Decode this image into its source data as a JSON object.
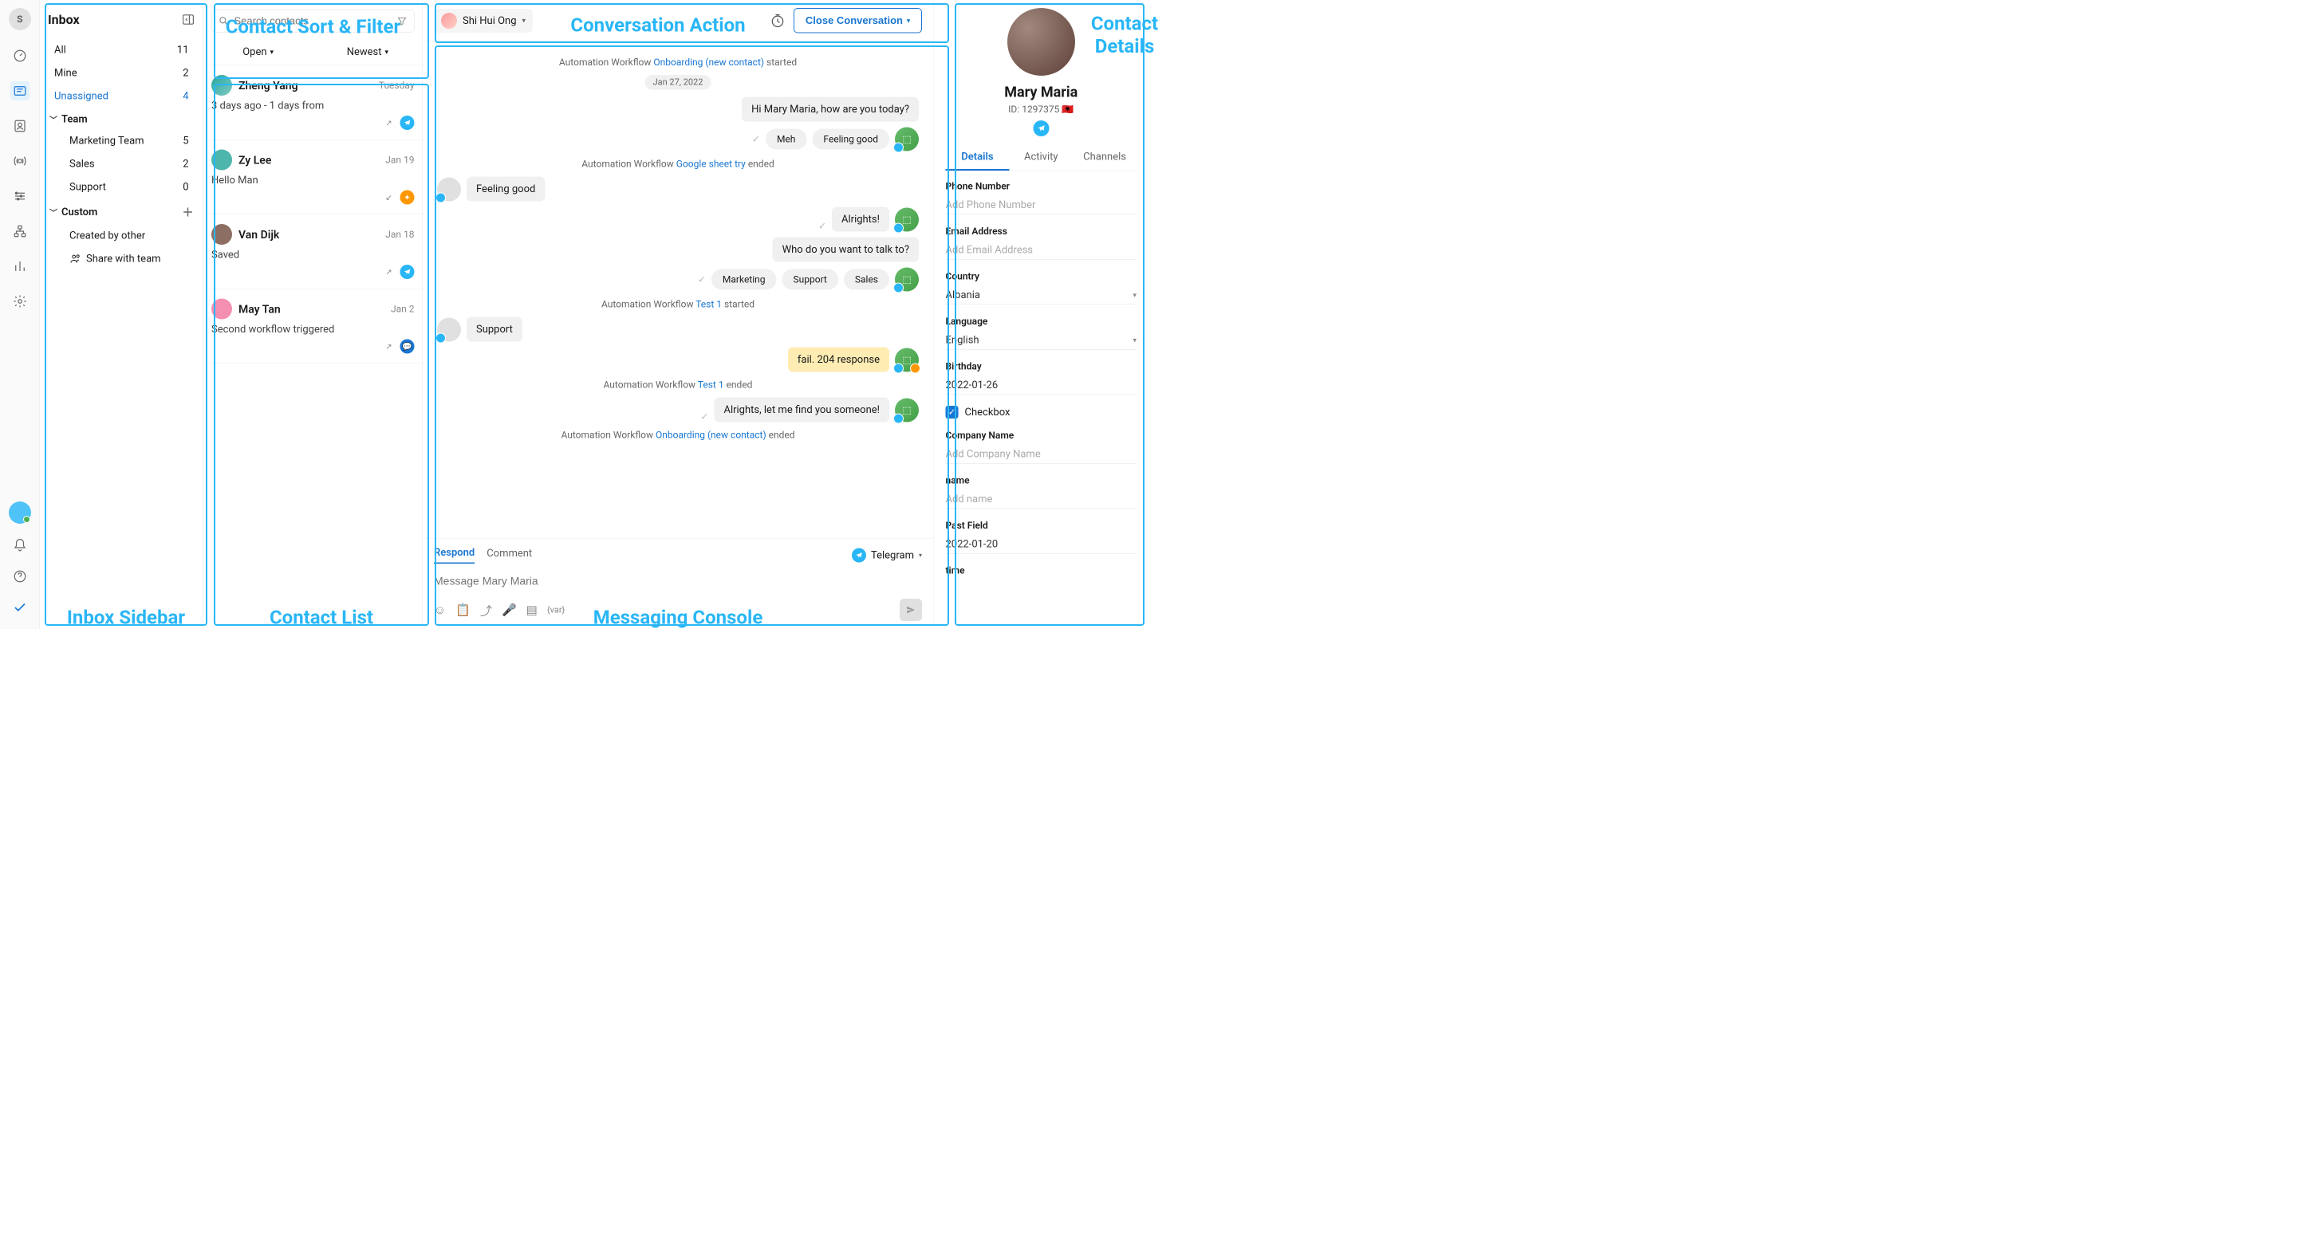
{
  "rail": {
    "avatar_initial": "S"
  },
  "inbox": {
    "title": "Inbox",
    "items": [
      {
        "label": "All",
        "count": "11"
      },
      {
        "label": "Mine",
        "count": "2"
      },
      {
        "label": "Unassigned",
        "count": "4"
      }
    ],
    "team_section": "Team",
    "team_items": [
      {
        "label": "Marketing Team",
        "count": "5"
      },
      {
        "label": "Sales",
        "count": "2"
      },
      {
        "label": "Support",
        "count": "0"
      }
    ],
    "custom_section": "Custom",
    "custom_items": [
      {
        "label": "Created by other"
      }
    ],
    "share_label": "Share with team"
  },
  "contact_list": {
    "search_placeholder": "Search contacts",
    "tab_open": "Open",
    "tab_newest": "Newest",
    "conversations": [
      {
        "name": "Zheng Yang",
        "date": "Tuesday",
        "preview": "3 days ago - 1 days from"
      },
      {
        "name": "Zy Lee",
        "date": "Jan 19",
        "preview": "Hello Man"
      },
      {
        "name": "Van Dijk",
        "date": "Jan 18",
        "preview": "Saved"
      },
      {
        "name": "May Tan",
        "date": "Jan 2",
        "preview": "Second workflow triggered"
      }
    ]
  },
  "console": {
    "assignee": "Shi Hui Ong",
    "close_label": "Close Conversation",
    "wf_prefix": "Automation Workflow ",
    "wf_onboarding": "Onboarding (new contact)",
    "started": " started",
    "ended": " ended",
    "date_pill": "Jan 27, 2022",
    "msg_hi": "Hi Mary Maria, how are you today?",
    "qr_meh": "Meh",
    "qr_good": "Feeling good",
    "wf_gsheet": "Google sheet try",
    "in_feeling": "Feeling good",
    "msg_alrights": "Alrights!",
    "msg_who": "Who do you want to talk to?",
    "qr_marketing": "Marketing",
    "qr_support": "Support",
    "qr_sales": "Sales",
    "wf_test1": "Test 1",
    "in_support": "Support",
    "msg_fail": "fail. 204 response",
    "msg_findyou": "Alrights, let me find you someone!",
    "composer": {
      "tab_respond": "Respond",
      "tab_comment": "Comment",
      "channel": "Telegram",
      "placeholder": "Message Mary Maria"
    }
  },
  "details": {
    "name": "Mary Maria",
    "id_label": "ID: 1297375",
    "flag": "🇦🇱",
    "tabs": {
      "details": "Details",
      "activity": "Activity",
      "channels": "Channels"
    },
    "fields": {
      "phone_label": "Phone Number",
      "phone_placeholder": "Add Phone Number",
      "email_label": "Email Address",
      "email_placeholder": "Add Email Address",
      "country_label": "Country",
      "country_value": "Albania",
      "language_label": "Language",
      "language_value": "English",
      "birthday_label": "Birthday",
      "birthday_value": "2022-01-26",
      "checkbox_label": "Checkbox",
      "company_label": "Company Name",
      "company_placeholder": "Add Company Name",
      "name_label": "name",
      "name_placeholder": "Add name",
      "past_label": "Past Field",
      "past_value": "2022-01-20",
      "time_label": "time"
    }
  },
  "annotations": {
    "sort_filter": "Contact Sort & Filter",
    "conv_action": "Conversation Action",
    "contact_details": "Contact Details",
    "inbox_sidebar": "Inbox Sidebar",
    "contact_list": "Contact List",
    "messaging_console": "Messaging Console"
  }
}
